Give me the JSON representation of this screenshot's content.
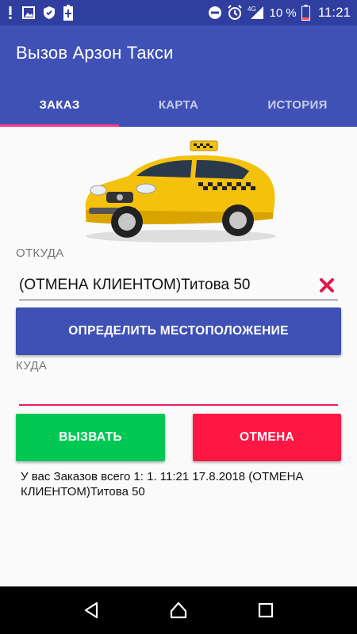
{
  "status_bar": {
    "battery_percent": "10 %",
    "time": "11:21",
    "network": "4G",
    "icons": [
      "alert-icon",
      "image-icon",
      "shield-icon",
      "battery-plus-icon",
      "dnd-icon",
      "alarm-icon",
      "signal-icon",
      "battery-icon"
    ]
  },
  "app_bar": {
    "title": "Вызов Арзон Такси",
    "color": "#3f51b5",
    "tabs": [
      {
        "label": "ЗАКАЗ",
        "active": true
      },
      {
        "label": "КАРТА",
        "active": false
      },
      {
        "label": "ИСТОРИЯ",
        "active": false
      }
    ],
    "indicator_color": "#ff4081"
  },
  "form": {
    "from_label": "ОТКУДА",
    "from_value": "(ОТМЕНА КЛИЕНТОМ)Титова 50",
    "clear_icon": "close-icon",
    "locate_button": "ОПРЕДЕЛИТЬ МЕСТОПОЛОЖЕНИЕ",
    "to_label": "КУДА",
    "to_value": "",
    "call_button": "ВЫЗВАТЬ",
    "cancel_button": "ОТМЕНА",
    "call_color": "#00c853",
    "cancel_color": "#ff1744"
  },
  "orders_text": "У вас Заказов всего 1:  1. 11:21 17.8.2018 (ОТМЕНА КЛИЕНТОМ)Титова 50",
  "nav_bar": {
    "icons": [
      "back-icon",
      "home-icon",
      "recents-icon"
    ]
  }
}
